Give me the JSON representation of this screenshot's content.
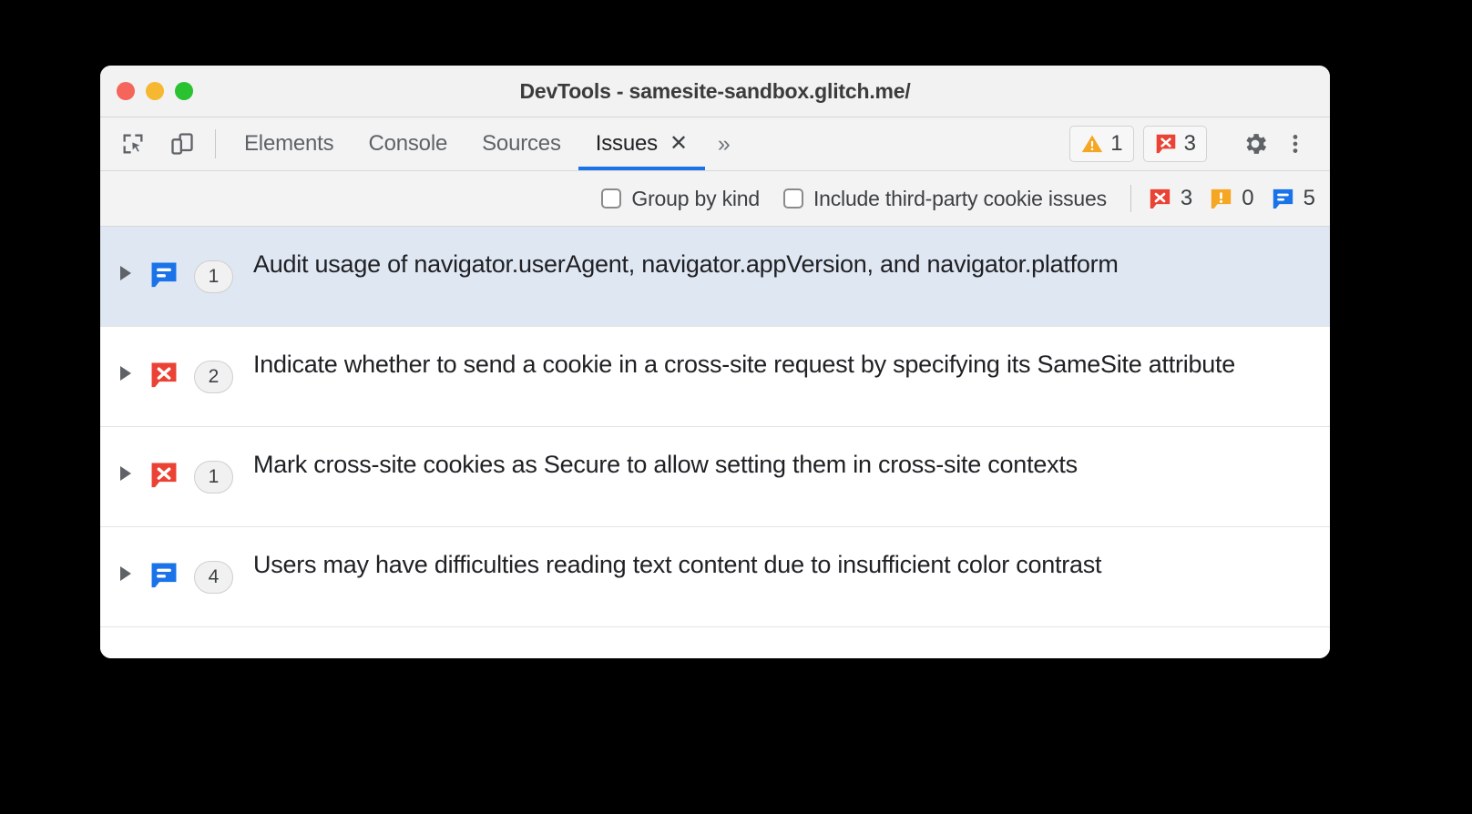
{
  "window": {
    "title": "DevTools - samesite-sandbox.glitch.me/",
    "traffic_lights": [
      {
        "name": "close",
        "color": "#f5655b"
      },
      {
        "name": "minimize",
        "color": "#f5b830"
      },
      {
        "name": "maximize",
        "color": "#2ac230"
      }
    ]
  },
  "toolbar": {
    "inspect_icon": "inspect-element-icon",
    "device_icon": "device-toolbar-icon",
    "settings_icon": "gear-icon",
    "more_icon": "kebab-menu-icon",
    "tabs": [
      {
        "label": "Elements",
        "active": false
      },
      {
        "label": "Console",
        "active": false
      },
      {
        "label": "Sources",
        "active": false
      },
      {
        "label": "Issues",
        "active": true
      }
    ],
    "tab_close_label": "✕",
    "more_tabs_label": "»",
    "warning_badge": {
      "icon": "warning-triangle-icon",
      "count": "1",
      "color": "#f5a623"
    },
    "error_badge": {
      "icon": "error-bubble-icon",
      "count": "3",
      "color": "#ea4335"
    }
  },
  "filterbar": {
    "group_by_kind": {
      "label": "Group by kind",
      "checked": false
    },
    "include_third_party": {
      "label": "Include third-party cookie issues",
      "checked": false
    },
    "tallies": [
      {
        "name": "error-tally",
        "icon": "error-bubble-icon",
        "count": "3",
        "color": "#ea4335"
      },
      {
        "name": "warning-tally",
        "icon": "warning-bubble-icon",
        "count": "0",
        "color": "#f5a623"
      },
      {
        "name": "info-tally",
        "icon": "info-bubble-icon",
        "count": "5",
        "color": "#1a73e8"
      }
    ]
  },
  "issues": [
    {
      "severity": "info",
      "icon": "info-bubble-icon",
      "color": "#1a73e8",
      "count": "1",
      "title": "Audit usage of navigator.userAgent, navigator.appVersion, and navigator.platform",
      "selected": true
    },
    {
      "severity": "error",
      "icon": "error-bubble-icon",
      "color": "#ea4335",
      "count": "2",
      "title": "Indicate whether to send a cookie in a cross-site request by specifying its SameSite attribute",
      "selected": false
    },
    {
      "severity": "error",
      "icon": "error-bubble-icon",
      "color": "#ea4335",
      "count": "1",
      "title": "Mark cross-site cookies as Secure to allow setting them in cross-site contexts",
      "selected": false
    },
    {
      "severity": "info",
      "icon": "info-bubble-icon",
      "color": "#1a73e8",
      "count": "4",
      "title": "Users may have difficulties reading text content due to insufficient color contrast",
      "selected": false
    }
  ]
}
